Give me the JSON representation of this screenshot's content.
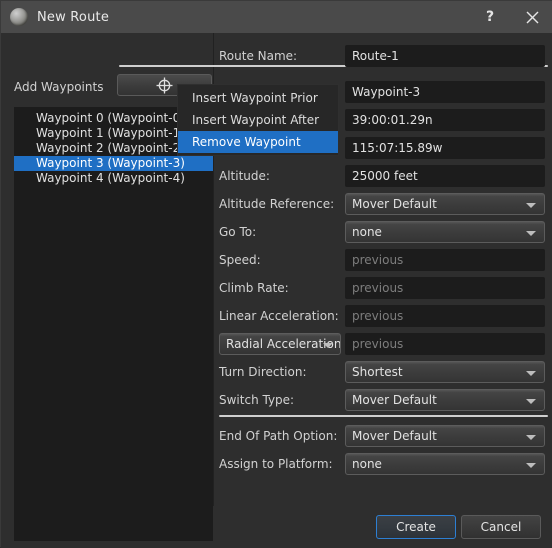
{
  "window": {
    "title": "New Route",
    "icon": "sphere-icon",
    "help_label": "?",
    "close_label": "✕"
  },
  "left_panel": {
    "add_waypoints_label": "Add Waypoints",
    "add_waypoints_button_icon": "crosshair-icon",
    "waypoints": [
      {
        "label": "Waypoint 0 (Waypoint-0)",
        "selected": false
      },
      {
        "label": "Waypoint 1 (Waypoint-1)",
        "selected": false
      },
      {
        "label": "Waypoint 2 (Waypoint-2)",
        "selected": false
      },
      {
        "label": "Waypoint 3 (Waypoint-3)",
        "selected": true
      },
      {
        "label": "Waypoint 4 (Waypoint-4)",
        "selected": false
      }
    ]
  },
  "context_menu": {
    "items": [
      {
        "label": "Insert Waypoint Prior",
        "highlighted": false
      },
      {
        "label": "Insert Waypoint After",
        "highlighted": false
      },
      {
        "label": "Remove Waypoint",
        "highlighted": true
      }
    ]
  },
  "route_name": {
    "label": "Route Name:",
    "value": "Route-1"
  },
  "fields": {
    "waypoint_name": {
      "value": "Waypoint-3"
    },
    "latitude": {
      "value": "39:00:01.29n"
    },
    "longitude": {
      "value": "115:07:15.89w"
    },
    "altitude": {
      "label": "Altitude:",
      "value": "25000 feet"
    },
    "altitude_reference": {
      "label": "Altitude Reference:",
      "value": "Mover Default"
    },
    "go_to": {
      "label": "Go To:",
      "value": "none"
    },
    "speed": {
      "label": "Speed:",
      "placeholder": "previous"
    },
    "climb_rate": {
      "label": "Climb Rate:",
      "placeholder": "previous"
    },
    "linear_acceleration": {
      "label": "Linear Acceleration:",
      "placeholder": "previous"
    },
    "radial_acceleration": {
      "label": "Radial Acceleration",
      "placeholder": "previous"
    },
    "turn_direction": {
      "label": "Turn Direction:",
      "value": "Shortest"
    },
    "switch_type": {
      "label": "Switch Type:",
      "value": "Mover Default"
    },
    "end_of_path_option": {
      "label": "End Of Path Option:",
      "value": "Mover Default"
    },
    "assign_to_platform": {
      "label": "Assign to Platform:",
      "value": "none"
    }
  },
  "footer": {
    "create_label": "Create",
    "cancel_label": "Cancel"
  },
  "colors": {
    "accent_blue": "#1f6fc4",
    "focus_blue": "#2d7fd3",
    "window_bg": "#2e2e2e",
    "titlebar_bg": "#4a4a4a",
    "input_bg": "#1c1c1c"
  }
}
